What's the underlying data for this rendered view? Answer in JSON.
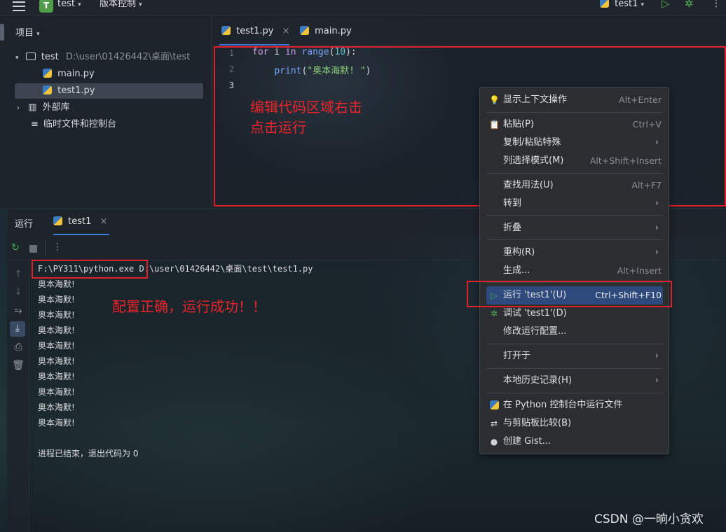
{
  "titlebar": {
    "project_badge": "T",
    "project_name": "test",
    "vcs_menu": "版本控制",
    "run_config": "test1"
  },
  "project_panel": {
    "title": "项目",
    "root_name": "test",
    "root_path": "D:\\user\\01426442\\桌面\\test",
    "files": [
      "main.py",
      "test1.py"
    ],
    "external_libs": "外部库",
    "scratches": "临时文件和控制台"
  },
  "editor": {
    "tabs": [
      "test1.py",
      "main.py"
    ],
    "line_numbers": [
      "1",
      "2",
      "3"
    ],
    "code": {
      "line1": {
        "kw1": "for",
        "var": " i ",
        "kw2": "in",
        "fn": " range",
        "p1": "(",
        "num": "10",
        "p2": "):"
      },
      "line2": {
        "indent": "    ",
        "fn": "print",
        "p1": "(",
        "str": "\"奥本海默! \"",
        "p2": ")"
      }
    }
  },
  "annotations": {
    "editor_note_1": "编辑代码区域右击",
    "editor_note_2": "点击运行",
    "console_note": "配置正确，运行成功！！"
  },
  "run_panel": {
    "title": "运行",
    "tab": "test1",
    "command_exe": "F:\\PY311\\python.exe",
    "command_script": " D:\\user\\01426442\\桌面\\test\\test1.py",
    "output_lines": [
      "奥本海默!",
      "奥本海默!",
      "奥本海默!",
      "奥本海默!",
      "奥本海默!",
      "奥本海默!",
      "奥本海默!",
      "奥本海默!",
      "奥本海默!",
      "奥本海默!"
    ],
    "exit_message": "进程已结束，退出代码为 0"
  },
  "context_menu": {
    "items": [
      {
        "label": "显示上下文操作",
        "shortcut": "Alt+Enter"
      },
      {
        "label": "粘贴(P)",
        "shortcut": "Ctrl+V"
      },
      {
        "label": "复制/粘贴特殊",
        "shortcut": ""
      },
      {
        "label": "列选择模式(M)",
        "shortcut": "Alt+Shift+Insert"
      },
      {
        "label": "查找用法(U)",
        "shortcut": "Alt+F7"
      },
      {
        "label": "转到",
        "shortcut": ""
      },
      {
        "label": "折叠",
        "shortcut": ""
      },
      {
        "label": "重构(R)",
        "shortcut": ""
      },
      {
        "label": "生成...",
        "shortcut": "Alt+Insert"
      },
      {
        "label": "运行 'test1'(U)",
        "shortcut": "Ctrl+Shift+F10"
      },
      {
        "label": "调试 'test1'(D)",
        "shortcut": ""
      },
      {
        "label": "修改运行配置...",
        "shortcut": ""
      },
      {
        "label": "打开于",
        "shortcut": ""
      },
      {
        "label": "本地历史记录(H)",
        "shortcut": ""
      },
      {
        "label": "在 Python 控制台中运行文件",
        "shortcut": ""
      },
      {
        "label": "与剪贴板比较(B)",
        "shortcut": ""
      },
      {
        "label": "创建 Gist...",
        "shortcut": ""
      }
    ]
  },
  "watermark": "CSDN @一晌小贪欢",
  "colors": {
    "annotation_red": "#e0202a",
    "menu_highlight": "#2e4a7d",
    "run_green": "#4caf50"
  }
}
